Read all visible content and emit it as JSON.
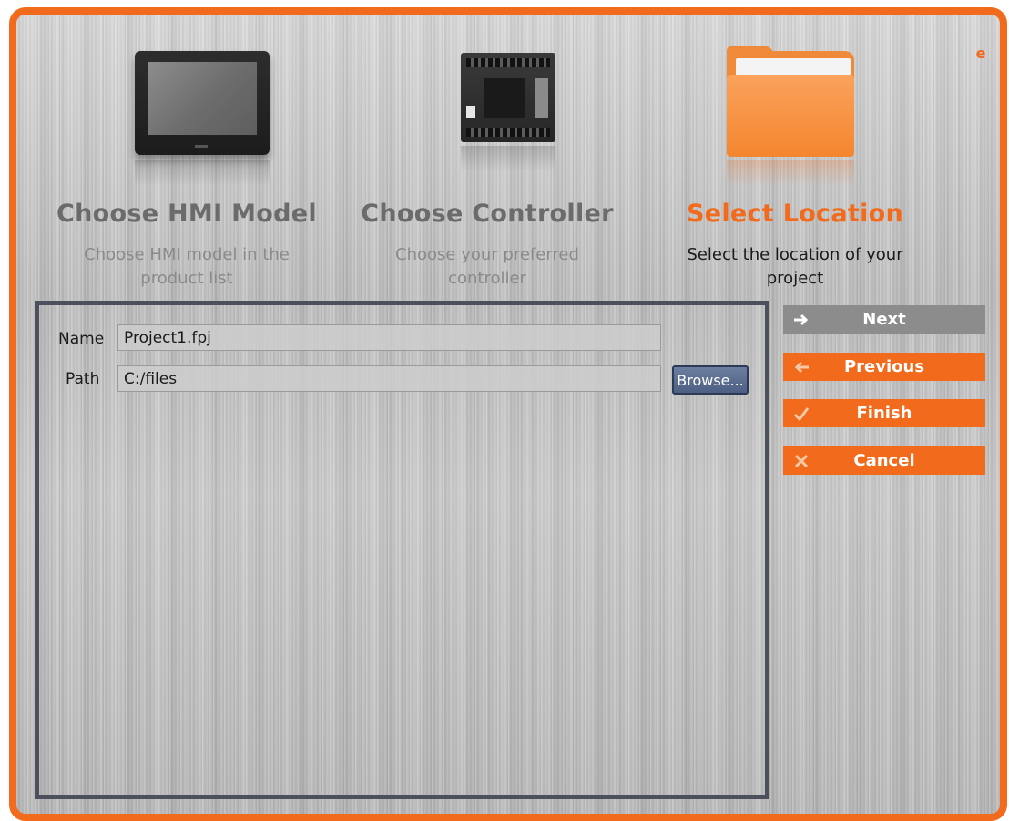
{
  "colors": {
    "accent": "#f26a1b",
    "inactive_title": "#6b6b6b",
    "inactive_desc": "#8a8a8a",
    "disabled_button": "#8c8c8c",
    "browse_button": "#5a6c8e"
  },
  "help_icon": "e",
  "steps": [
    {
      "title": "Choose HMI Model",
      "description": "Choose HMI model in the product list",
      "image": "hmi-device-image",
      "active": false
    },
    {
      "title": "Choose Controller",
      "description": "Choose your preferred controller",
      "image": "plc-controller-image",
      "active": false
    },
    {
      "title": "Select Location",
      "description": "Select the location of your project",
      "image": "folder-image",
      "active": true
    }
  ],
  "form": {
    "name_label": "Name",
    "name_value": "Project1.fpj",
    "path_label": "Path",
    "path_value": "C:/files",
    "browse_label": "Browse..."
  },
  "buttons": {
    "next": {
      "label": "Next",
      "icon": "arrow-right-icon",
      "enabled": false
    },
    "previous": {
      "label": "Previous",
      "icon": "arrow-left-icon",
      "enabled": true
    },
    "finish": {
      "label": "Finish",
      "icon": "checkmark-icon",
      "enabled": true
    },
    "cancel": {
      "label": "Cancel",
      "icon": "x-icon",
      "enabled": true
    }
  }
}
